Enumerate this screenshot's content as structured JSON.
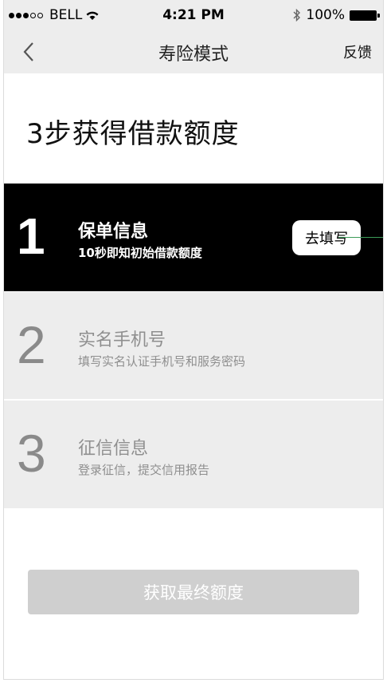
{
  "status_bar": {
    "carrier": "BELL",
    "time": "4:21 PM",
    "battery": "100%"
  },
  "nav": {
    "title": "寿险模式",
    "feedback": "反馈"
  },
  "main": {
    "title": "3步获得借款额度",
    "steps": [
      {
        "number": "1",
        "name": "保单信息",
        "desc": "10秒即知初始借款额度",
        "action": "去填写"
      },
      {
        "number": "2",
        "name": "实名手机号",
        "desc": "填写实名认证手机号和服务密码"
      },
      {
        "number": "3",
        "name": "征信信息",
        "desc": "登录征信，提交信用报告"
      }
    ],
    "final_button": "获取最终额度"
  },
  "colors": {
    "active_step_bg": "#000000",
    "inactive_step_bg": "#ededed",
    "header_bg": "#ededed",
    "disabled_button_bg": "#cfcfcf"
  }
}
